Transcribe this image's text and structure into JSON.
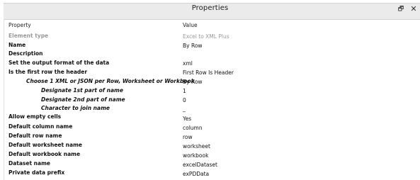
{
  "panel": {
    "title": "Properties",
    "pin_glyph": "🗗",
    "close_glyph": "✕",
    "header": {
      "property": "Property",
      "value": "Value"
    }
  },
  "rows": [
    {
      "name": "element-type",
      "label": "Element type",
      "value": "Excel to XML Plus"
    },
    {
      "name": "name",
      "label": "Name",
      "value": "By Row"
    },
    {
      "name": "description",
      "label": "Description",
      "value": ""
    },
    {
      "name": "output-format",
      "label": "Set the output format of the data",
      "value": "xml"
    },
    {
      "name": "first-row-header",
      "label": "Is the first row the header",
      "value": "First Row Is Header"
    },
    {
      "name": "choose-per",
      "label": "Choose 1 XML or JSON per Row, Worksheet or Workbook",
      "value": "By Row"
    },
    {
      "name": "designate-1st",
      "label": "Designate 1st part of name",
      "value": "1"
    },
    {
      "name": "designate-2nd",
      "label": "Designate 2nd part of name",
      "value": "0"
    },
    {
      "name": "join-char",
      "label": "Character to join name",
      "value": "_"
    },
    {
      "name": "allow-empty",
      "label": "Allow empty cells",
      "value": "Yes"
    },
    {
      "name": "default-column",
      "label": "Default column name",
      "value": "column"
    },
    {
      "name": "default-row",
      "label": "Default row name",
      "value": "row"
    },
    {
      "name": "default-worksheet",
      "label": "Default worksheet name",
      "value": "worksheet"
    },
    {
      "name": "default-workbook",
      "label": "Default workbook name",
      "value": "workbook"
    },
    {
      "name": "dataset-name",
      "label": "Dataset name",
      "value": "excelDataset"
    },
    {
      "name": "private-prefix",
      "label": "Private data prefix",
      "value": "exPDData"
    }
  ]
}
